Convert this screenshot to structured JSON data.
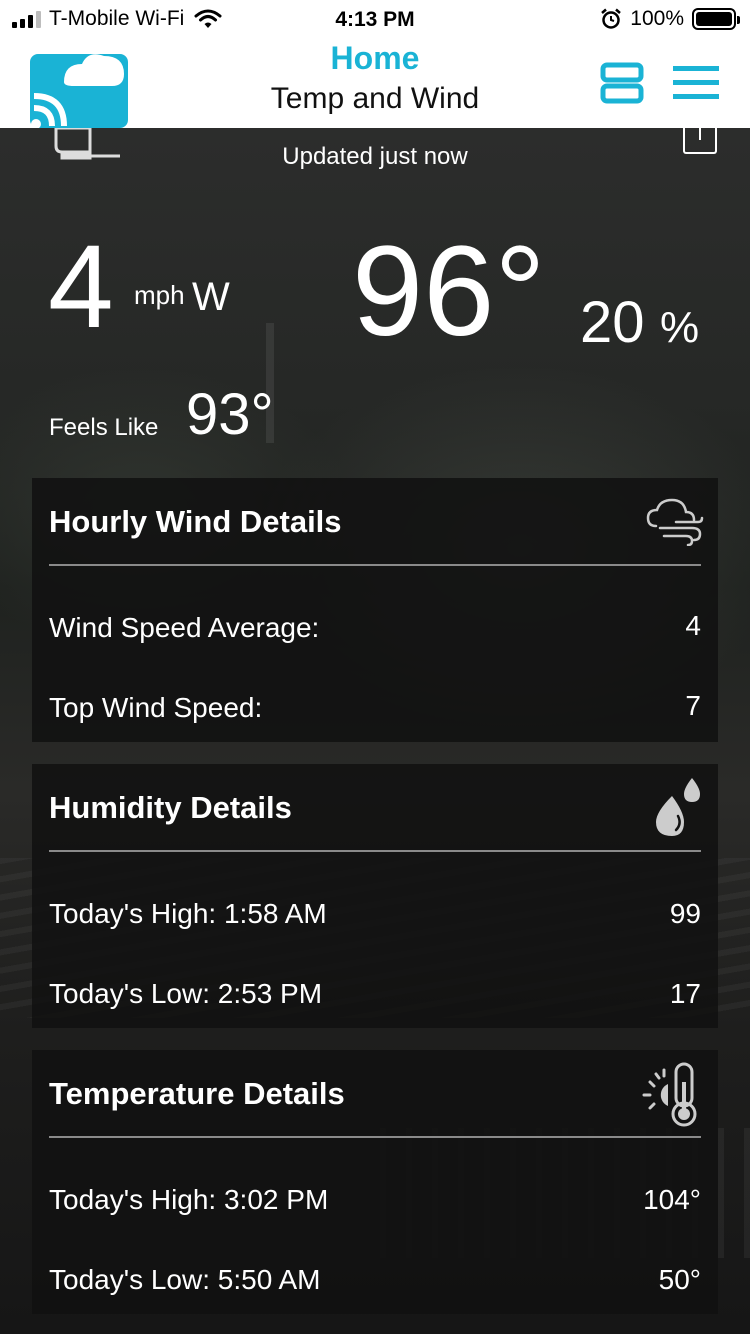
{
  "status_bar": {
    "carrier": "T-Mobile Wi-Fi",
    "time": "4:13 PM",
    "battery": "100%",
    "icons": [
      "signal-icon",
      "wifi-icon",
      "alarm-icon",
      "battery-icon"
    ]
  },
  "header": {
    "title": "Home",
    "subtitle": "Temp and Wind",
    "accent_color": "#1ab3d5",
    "icons": [
      "app-logo-icon",
      "layout-toggle-icon",
      "hamburger-menu-icon"
    ]
  },
  "current": {
    "updated": "Updated just now",
    "wind_speed": "4",
    "wind_unit": "mph",
    "wind_direction": "W",
    "temperature": "96°",
    "humidity_value": "20",
    "humidity_unit": "%",
    "feels_like_label": "Feels Like",
    "feels_like_value": "93°"
  },
  "panels": {
    "wind": {
      "title": "Hourly Wind Details",
      "icon": "wind-cloud-icon",
      "rows": [
        {
          "label": "Wind Speed Average:",
          "value": "4"
        },
        {
          "label": "Top Wind Speed:",
          "value": "7"
        }
      ]
    },
    "humidity": {
      "title": "Humidity Details",
      "icon": "water-drops-icon",
      "rows": [
        {
          "label": "Today's High: 1:58 AM",
          "value": "99"
        },
        {
          "label": "Today's Low: 2:53 PM",
          "value": "17"
        }
      ]
    },
    "temperature": {
      "title": "Temperature Details",
      "icon": "sun-thermometer-icon",
      "rows": [
        {
          "label": "Today's High: 3:02 PM",
          "value": "104°"
        },
        {
          "label": "Today's Low: 5:50 AM",
          "value": "50°"
        }
      ]
    }
  }
}
